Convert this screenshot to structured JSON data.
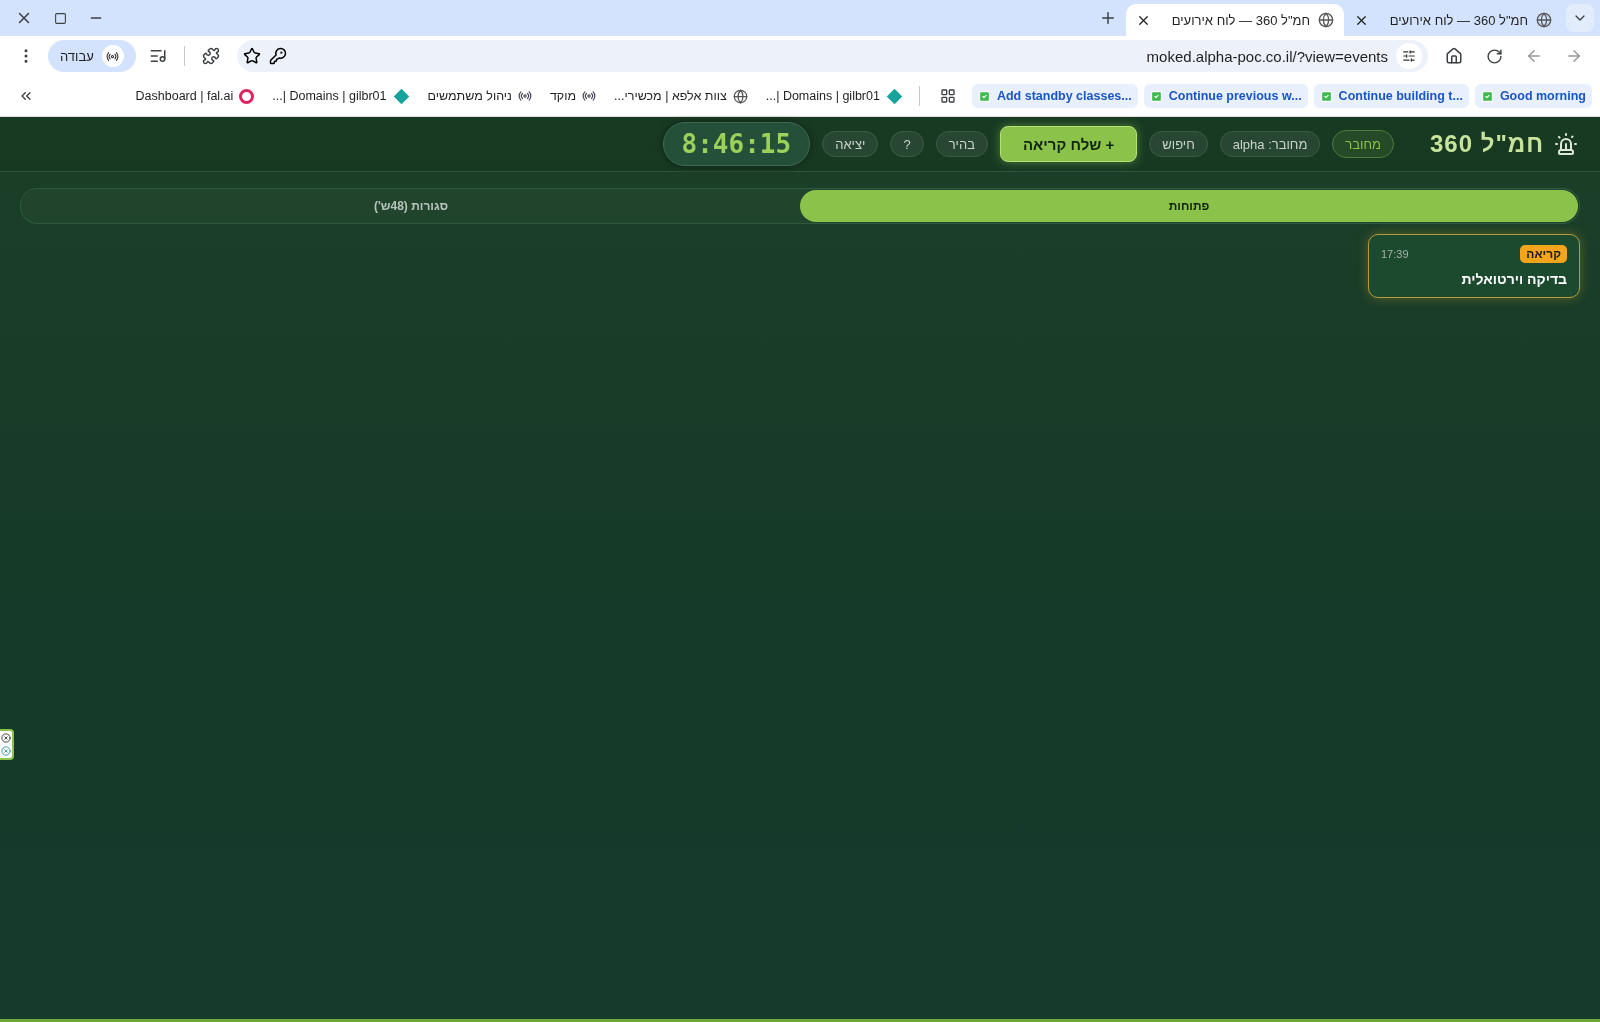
{
  "browser": {
    "tabs": [
      {
        "title": "חמ\"ל 360 — לוח אירועים",
        "selected": false
      },
      {
        "title": "חמ\"ל 360 — לוח אירועים",
        "selected": true
      }
    ],
    "address": "moked.alpha-poc.co.il/?view=events",
    "profile": "עבודה",
    "bookmarks": [
      {
        "kind": "task",
        "label": "Good morning"
      },
      {
        "kind": "task",
        "label": "Continue building t..."
      },
      {
        "kind": "task",
        "label": "Continue previous w..."
      },
      {
        "kind": "task",
        "label": "Add standby classes..."
      },
      {
        "kind": "apps"
      },
      {
        "kind": "diamond",
        "label": "Domains | gilbr01 |..."
      },
      {
        "kind": "globe",
        "label": "צוות אלפא | מכשירי..."
      },
      {
        "kind": "walkie",
        "label": "מוקד"
      },
      {
        "kind": "walkie",
        "label": "ניהול משתמשים"
      },
      {
        "kind": "diamond",
        "label": "Domains | gilbr01 |..."
      },
      {
        "kind": "ring",
        "label": "Dashboard | fal.ai"
      }
    ]
  },
  "app": {
    "title": "חמ\"ל 360",
    "header_items": [
      {
        "kind": "status",
        "label": "מחובר"
      },
      {
        "kind": "pill",
        "label": "מחובר: alpha"
      },
      {
        "kind": "pill",
        "label": "חיפוש"
      },
      {
        "kind": "primary",
        "label": "+ שלח קריאה"
      },
      {
        "kind": "pill",
        "label": "בהיר"
      },
      {
        "kind": "pill",
        "label": "?"
      },
      {
        "kind": "pill",
        "label": "יציאה"
      }
    ],
    "clock": "8:46:15",
    "view_tabs": [
      {
        "label": "פתוחות",
        "selected": true
      },
      {
        "label": "סגורות (48ש')",
        "selected": false
      }
    ],
    "events": [
      {
        "badge": "קריאה",
        "time": "17:39",
        "title": "בדיקה וירטואלית"
      }
    ]
  }
}
